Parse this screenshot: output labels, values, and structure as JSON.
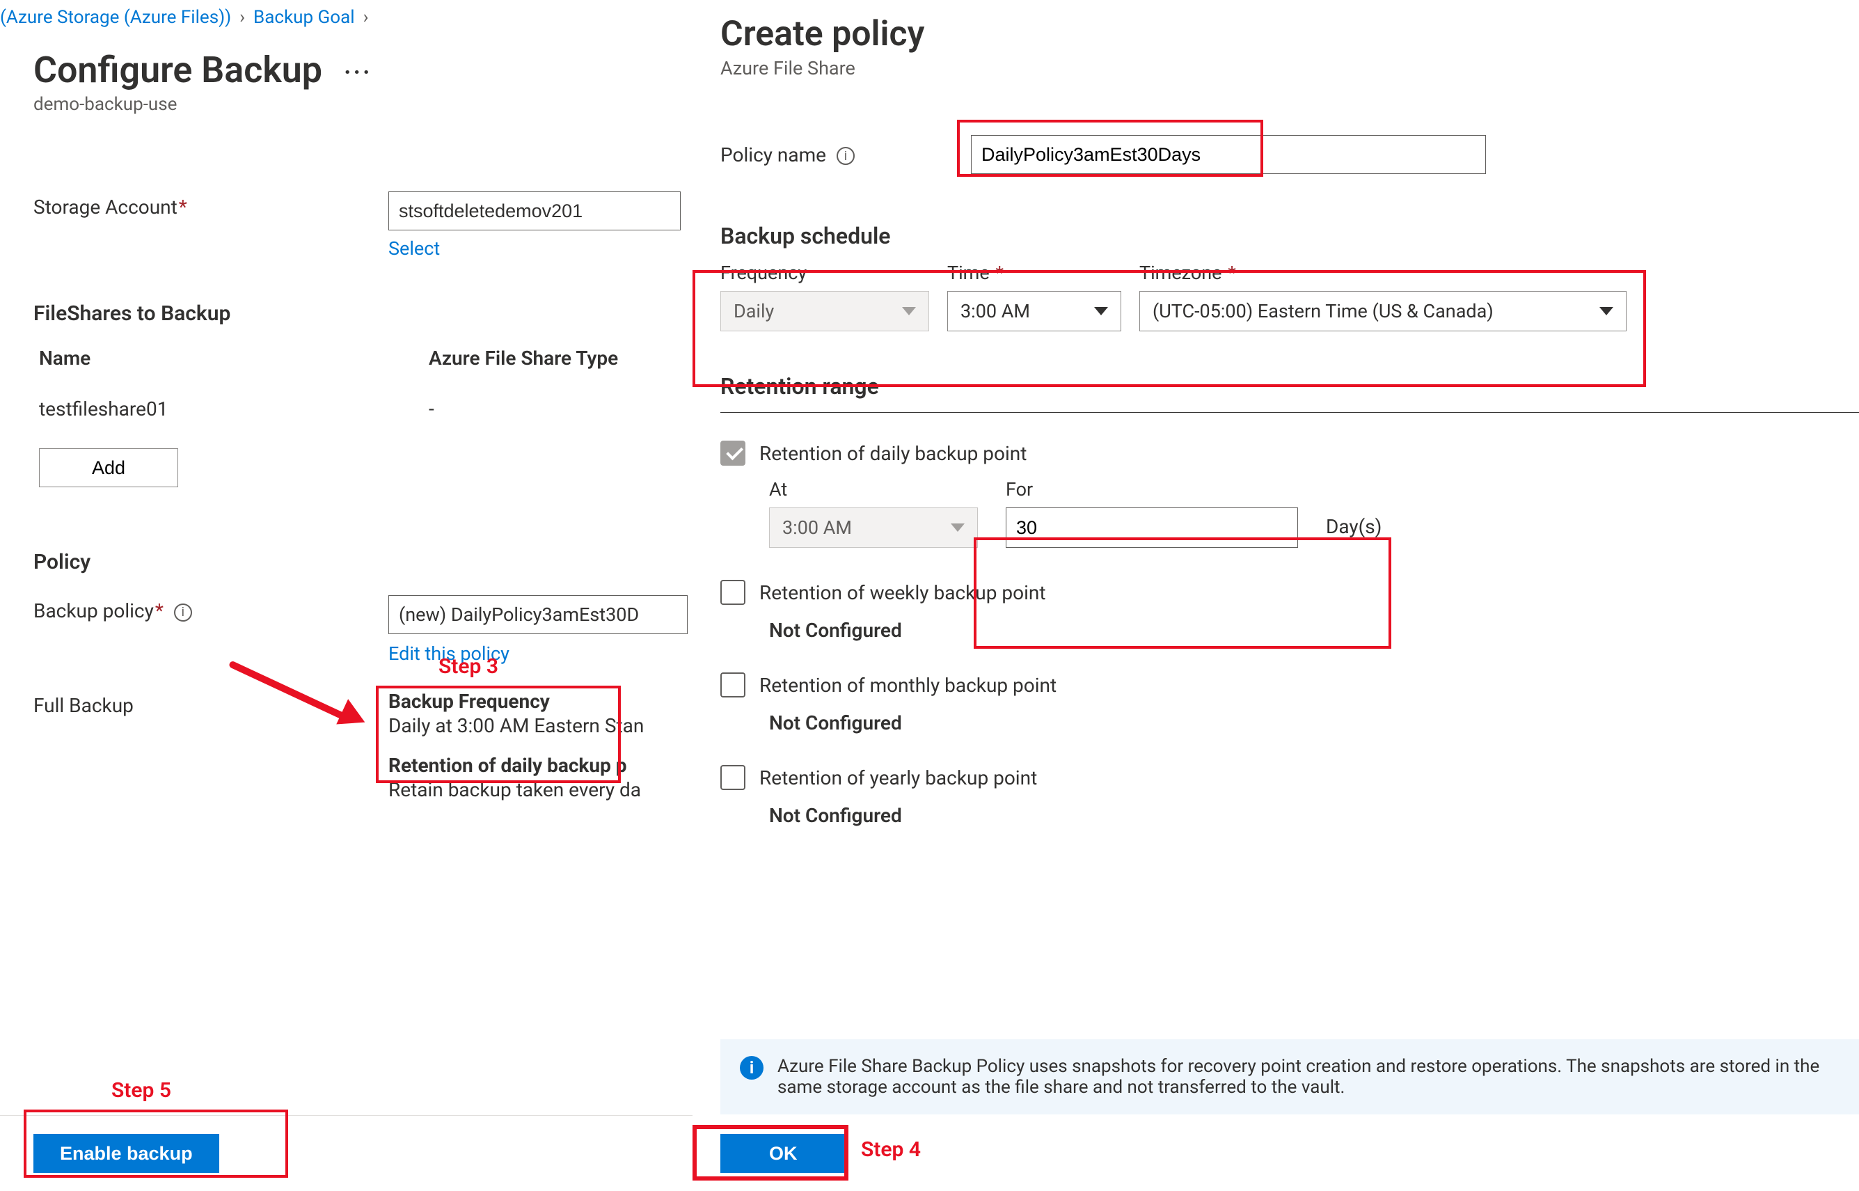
{
  "breadcrumb": {
    "item1": "(Azure Storage (Azure Files))",
    "item2": "Backup Goal"
  },
  "left": {
    "title": "Configure Backup",
    "subtitle": "demo-backup-use",
    "storage_account_label": "Storage Account",
    "storage_account_value": "stsoftdeletedemov201",
    "select_link": "Select",
    "fileshares_heading": "FileShares to Backup",
    "col_name": "Name",
    "col_type": "Azure File Share Type",
    "row_name": "testfileshare01",
    "row_type": "-",
    "add_btn": "Add",
    "policy_heading": "Policy",
    "backup_policy_label": "Backup policy",
    "backup_policy_value": "(new) DailyPolicy3amEst30D",
    "edit_policy_link": "Edit this policy",
    "full_backup_label": "Full Backup",
    "freq_heading": "Backup Frequency",
    "freq_text": "Daily at 3:00 AM Eastern Stan",
    "ret_heading": "Retention of daily backup p",
    "ret_text": "Retain backup taken every da",
    "enable_btn": "Enable backup"
  },
  "right": {
    "title": "Create policy",
    "subtitle": "Azure File Share",
    "policy_name_label": "Policy name",
    "policy_name_value": "DailyPolicy3amEst30Days",
    "backup_schedule_heading": "Backup schedule",
    "freq_label": "Frequency",
    "freq_value": "Daily",
    "time_label": "Time",
    "time_value": "3:00 AM",
    "tz_label": "Timezone",
    "tz_value": "(UTC-05:00) Eastern Time (US & Canada)",
    "retention_heading": "Retention range",
    "ret_daily_label": "Retention of daily backup point",
    "at_label": "At",
    "at_value": "3:00 AM",
    "for_label": "For",
    "for_value": "30",
    "for_unit": "Day(s)",
    "ret_weekly_label": "Retention of weekly backup point",
    "ret_monthly_label": "Retention of monthly backup point",
    "ret_yearly_label": "Retention of yearly backup point",
    "not_configured": "Not Configured",
    "info_text": "Azure File Share Backup Policy uses snapshots for recovery point creation and restore operations. The snapshots are stored in the same storage account as the file share and not transferred to the vault.",
    "ok_btn": "OK"
  },
  "annotations": {
    "step3": "Step 3",
    "step4": "Step 4",
    "step5": "Step 5"
  }
}
